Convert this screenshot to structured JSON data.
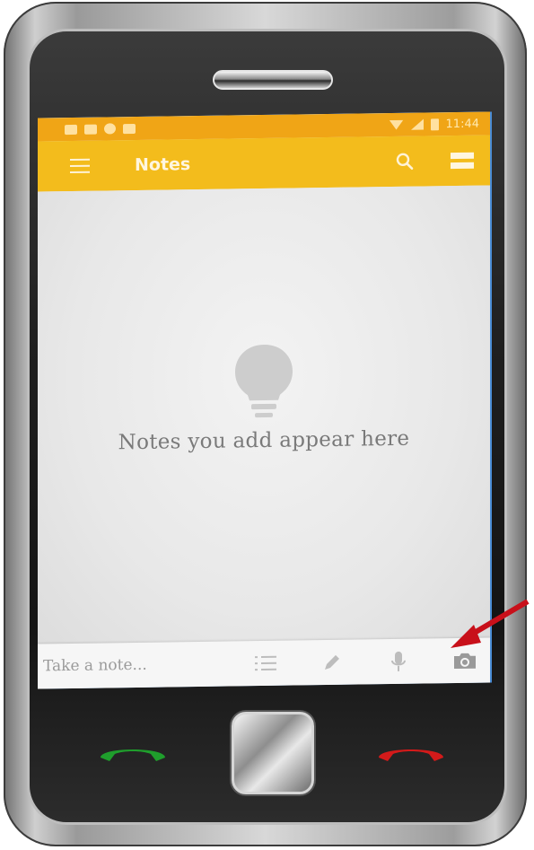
{
  "status_bar": {
    "time": "11:44"
  },
  "app_bar": {
    "title": "Notes",
    "menu_icon": "hamburger-menu-icon",
    "search_icon": "search-icon",
    "view_icon": "view-toggle-icon"
  },
  "content": {
    "empty_message": "Notes you add appear here",
    "illustration_icon": "lightbulb-icon"
  },
  "bottom_bar": {
    "placeholder": "Take a note...",
    "actions": [
      {
        "icon": "list-icon"
      },
      {
        "icon": "pen-icon"
      },
      {
        "icon": "microphone-icon"
      },
      {
        "icon": "camera-icon"
      }
    ]
  },
  "colors": {
    "status_bar": "#f0a516",
    "app_bar": "#f3bc1c",
    "content_background": "#ececec",
    "call_accept": "#1f9e2c",
    "call_end": "#d31a1a",
    "annotation_arrow": "#c8101a"
  },
  "hardware": {
    "accept_icon": "phone-accept-icon",
    "end_icon": "phone-end-icon",
    "home_icon": "home-button-icon"
  }
}
